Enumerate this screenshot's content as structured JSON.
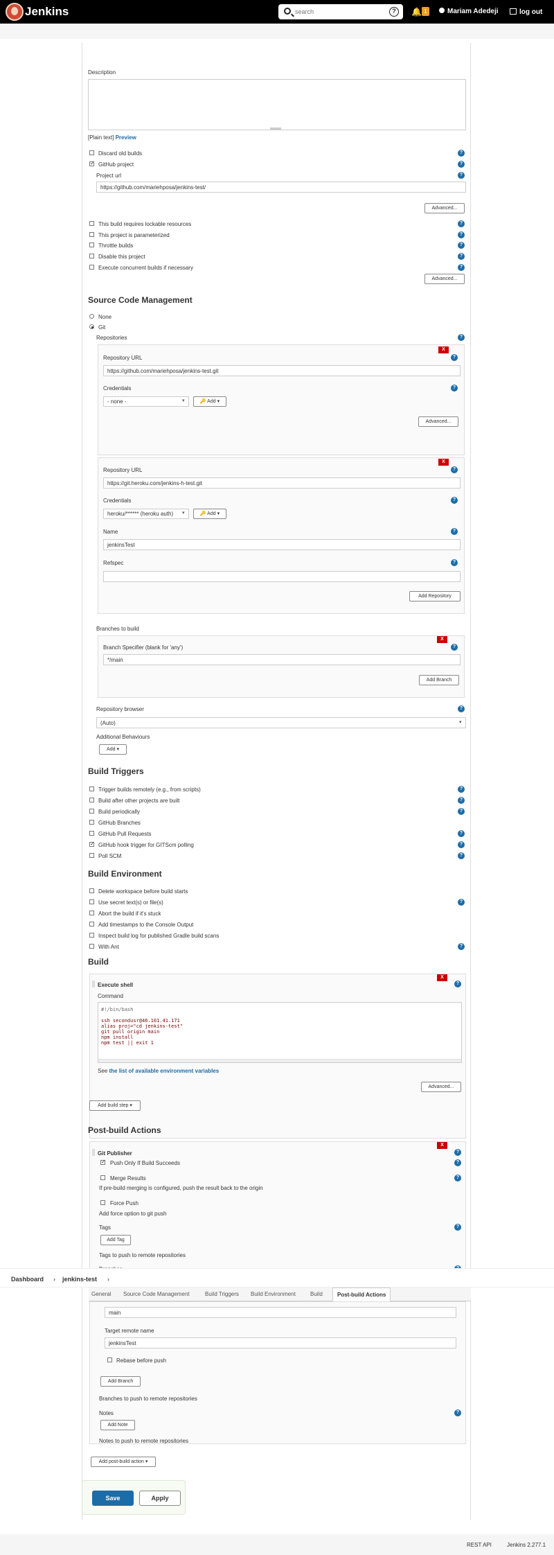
{
  "header": {
    "brand": "Jenkins",
    "search_placeholder": "search",
    "search_help": "?",
    "notification_count": "1",
    "user_name": "Mariam Adedeji",
    "logout": "log out"
  },
  "general": {
    "description_label": "Description",
    "plain_text": "[Plain text]",
    "preview": "Preview",
    "discard_old_builds": "Discard old builds",
    "github_project": "GitHub project",
    "project_url_label": "Project url",
    "project_url_value": "https://github.com/mariehposa/jenkins-test/",
    "advanced_1": "Advanced...",
    "lockable": "This build requires lockable resources",
    "parameterized": "This project is parameterized",
    "throttle": "Throttle builds",
    "disable": "Disable this project",
    "concurrent": "Execute concurrent builds if necessary",
    "advanced_2": "Advanced..."
  },
  "scm": {
    "title": "Source Code Management",
    "none": "None",
    "git": "Git",
    "repositories_label": "Repositories",
    "repo1": {
      "x": "X",
      "url_label": "Repository URL",
      "url_value": "https://github.com/mariehposa/jenkins-test.git",
      "cred_label": "Credentials",
      "cred_value": "- none -",
      "add": "Add",
      "advanced": "Advanced..."
    },
    "repo2": {
      "x": "X",
      "url_label": "Repository URL",
      "url_value": "https://git.heroku.com/jenkins-h-test.git",
      "cred_label": "Credentials",
      "cred_value": "heroku/****** (heroku auth)",
      "add": "Add",
      "name_label": "Name",
      "name_value": "jenkinsTest",
      "refspec_label": "Refspec",
      "add_repository": "Add Repository"
    },
    "branches_label": "Branches to build",
    "branch_x": "X",
    "branch_specifier_label": "Branch Specifier (blank for 'any')",
    "branch_specifier_value": "*/main",
    "add_branch": "Add Branch",
    "repo_browser_label": "Repository browser",
    "repo_browser_value": "(Auto)",
    "additional_behaviours": "Additional Behaviours",
    "add": "Add"
  },
  "triggers": {
    "title": "Build Triggers",
    "items": [
      {
        "label": "Trigger builds remotely (e.g., from scripts)",
        "checked": false
      },
      {
        "label": "Build after other projects are built",
        "checked": false
      },
      {
        "label": "Build periodically",
        "checked": false
      },
      {
        "label": "GitHub Branches",
        "checked": false
      },
      {
        "label": "GitHub Pull Requests",
        "checked": false
      },
      {
        "label": "GitHub hook trigger for GITScm polling",
        "checked": true
      },
      {
        "label": "Poll SCM",
        "checked": false
      }
    ]
  },
  "environment": {
    "title": "Build Environment",
    "items": [
      {
        "label": "Delete workspace before build starts"
      },
      {
        "label": "Use secret text(s) or file(s)"
      },
      {
        "label": "Abort the build if it's stuck"
      },
      {
        "label": "Add timestamps to the Console Output"
      },
      {
        "label": "Inspect build log for published Gradle build scans"
      },
      {
        "label": "With Ant"
      }
    ]
  },
  "build": {
    "title": "Build",
    "x": "X",
    "step_title": "Execute shell",
    "command_label": "Command",
    "command_lines": [
      "#!/bin/bash",
      "",
      "ssh secondusr@46.101.41.171",
      "alias proj=\"cd jenkins-test\"",
      "git pull origin main",
      "npm install",
      "npm test || exit 1"
    ],
    "see": "See ",
    "env_vars_link": "the list of available environment variables",
    "advanced": "Advanced...",
    "add_build_step": "Add build step"
  },
  "post": {
    "title": "Post-build Actions",
    "x": "X",
    "publisher_title": "Git Publisher",
    "push_only": "Push Only If Build Succeeds",
    "merge_results": "Merge Results",
    "merge_desc": "If pre-build merging is configured, push the result back to the origin",
    "force_push": "Force Push",
    "force_desc": "Add force option to git push",
    "tags_label": "Tags",
    "add_tag": "Add Tag",
    "tags_desc": "Tags to push to remote repositories",
    "branches_label": "Branches",
    "branch_value": "main",
    "target_remote_label": "Target remote name",
    "target_remote_value": "jenkinsTest",
    "rebase": "Rebase before push",
    "add_branch": "Add Branch",
    "branches_desc": "Branches to push to remote repositories",
    "notes_label": "Notes",
    "add_note": "Add Note",
    "notes_desc": "Notes to push to remote repositories",
    "add_post_build": "Add post-build action"
  },
  "breadcrumb": {
    "dashboard": "Dashboard",
    "sep": "›",
    "project": "jenkins-test",
    "sep2": "›"
  },
  "tabs": [
    "General",
    "Source Code Management",
    "Build Triggers",
    "Build Environment",
    "Build",
    "Post-build Actions"
  ],
  "actions": {
    "save": "Save",
    "apply": "Apply"
  },
  "footer": {
    "rest_api": "REST API",
    "version": "Jenkins 2.277.1"
  },
  "colors": {
    "accent": "#1c6ca8",
    "danger": "#cc0000",
    "save": "#1c6ca8"
  }
}
